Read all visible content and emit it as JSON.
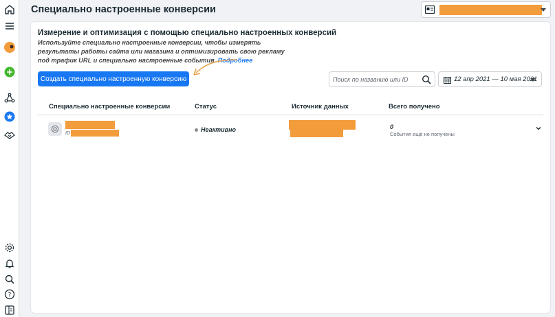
{
  "header": {
    "title": "Специально настроенные конверсии"
  },
  "intro": {
    "title": "Измерение и оптимизация с помощью специально настроенных конверсий",
    "description": "Используйте специально настроенные конверсии, чтобы измерять результаты работы сайта или магазина и оптимизировать свою рекламу под трафик URL и специально настроенные события.",
    "learn_more": "Подробнее"
  },
  "toolbar": {
    "create_label": "Создать специально настроенную конверсию",
    "search_placeholder": "Поиск по названию или ID",
    "date_range": "12 апр 2021 — 10 мая 2021"
  },
  "table": {
    "columns": [
      "Специально настроенные конверсии",
      "Статус",
      "Источник данных",
      "Всего получено"
    ],
    "rows": [
      {
        "id_label": "ID",
        "status": "Неактивно",
        "received": "0",
        "received_note": "События ещё не получены"
      }
    ]
  },
  "colors": {
    "accent": "#1877f2",
    "redaction": "#f39c3c",
    "success": "#42b72a",
    "arrow": "#e8a04a"
  },
  "icons": [
    "home-icon",
    "menu-icon",
    "avatar",
    "plus-icon",
    "graph-icon",
    "star-icon",
    "handshake-icon",
    "gear-icon",
    "bell-icon",
    "search-icon",
    "help-icon",
    "panel-icon"
  ]
}
